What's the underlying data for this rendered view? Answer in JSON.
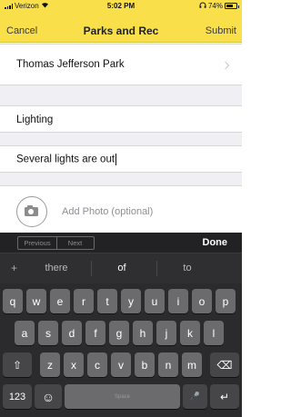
{
  "status_bar": {
    "carrier": "Verizon",
    "time": "5:02 PM",
    "battery_percent": "74%",
    "battery_level": 0.74
  },
  "nav": {
    "cancel": "Cancel",
    "title": "Parks and Rec",
    "submit": "Submit"
  },
  "form": {
    "park": "Thomas Jefferson Park",
    "category": "Lighting",
    "description": "Several lights are out",
    "photo_label": "Add Photo (optional)"
  },
  "accessory": {
    "previous": "Previous",
    "next": "Next",
    "done": "Done"
  },
  "predictive": {
    "plus": "+",
    "suggestions": [
      "there",
      "of",
      "to"
    ]
  },
  "keyboard": {
    "row1": [
      "q",
      "w",
      "e",
      "r",
      "t",
      "y",
      "u",
      "i",
      "o",
      "p"
    ],
    "row2": [
      "a",
      "s",
      "d",
      "f",
      "g",
      "h",
      "j",
      "k",
      "l"
    ],
    "row3": [
      "z",
      "x",
      "c",
      "v",
      "b",
      "n",
      "m"
    ],
    "shift": "⇧",
    "backspace": "⌫",
    "numbers": "123",
    "emoji": "☺",
    "space": "Space",
    "mic": "🎤",
    "return": "↵"
  },
  "colors": {
    "header_yellow": "#f9e04b",
    "keyboard_bg": "#2b2b2d"
  }
}
